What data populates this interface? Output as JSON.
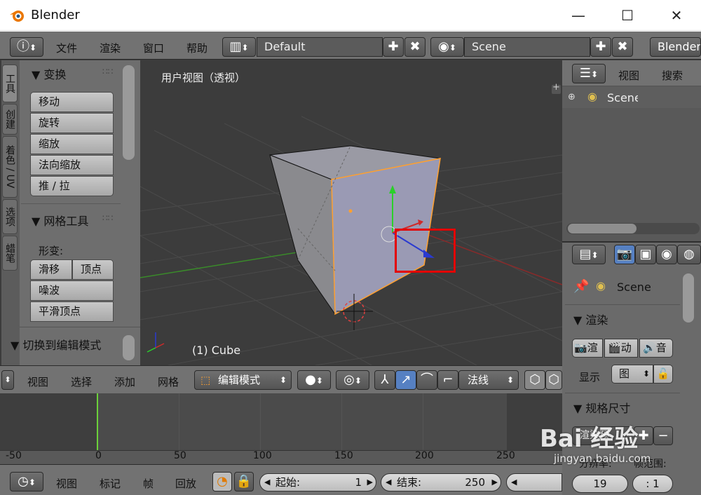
{
  "window": {
    "title": "Blender",
    "minimize": "—",
    "maximize": "☐",
    "close": "✕"
  },
  "info_header": {
    "menus": [
      "文件",
      "渲染",
      "窗口",
      "帮助"
    ],
    "layout": "Default",
    "scene": "Scene",
    "engine": "Blender"
  },
  "tool_tabs": [
    "工具",
    "创建",
    "着色 / UV",
    "选项",
    "蜡笔"
  ],
  "tools": {
    "transform_title": "变换",
    "transform_buttons": [
      "移动",
      "旋转",
      "缩放",
      "法向缩放",
      "推 / 拉"
    ],
    "mesh_title": "网格工具",
    "deform_label": "形变:",
    "slide": "滑移",
    "vertex": "顶点",
    "noise": "噪波",
    "smooth": "平滑顶点",
    "switch_title": "切换到编辑模式"
  },
  "viewport": {
    "view_label": "用户视图（透视）",
    "object_label": "(1) Cube",
    "plus": "+"
  },
  "viewport_header": {
    "menus": [
      "视图",
      "选择",
      "添加",
      "网格"
    ],
    "mode": "编辑模式",
    "orientation": "法线"
  },
  "timeline": {
    "ruler_ticks": [
      "-50",
      "0",
      "50",
      "100",
      "150",
      "200",
      "250"
    ],
    "menus": [
      "视图",
      "标记",
      "帧",
      "回放"
    ],
    "start_label": "起始:",
    "start_value": "1",
    "end_label": "结束:",
    "end_value": "250"
  },
  "outliner": {
    "tabs": [
      "视图",
      "搜索"
    ],
    "scene_item": "Scene"
  },
  "properties": {
    "scene_path": "Scene",
    "render_title": "渲染",
    "render_buttons": [
      "渲",
      "动",
      "音"
    ],
    "display_label": "显示",
    "display_value": "图",
    "dimensions_title": "规格尺寸",
    "render_preset": "渲染预",
    "resolution_label": "分辨率:",
    "frame_range_label": "帧范围:",
    "res_value": "19",
    "frame_value": ": 1"
  },
  "watermark": {
    "brand_text": "Bai 经验",
    "url": "jingyan.baidu.com"
  },
  "colors": {
    "highlight_box": "#e30000",
    "selection": "#ffa030",
    "frame_cursor": "#6bd03a"
  }
}
